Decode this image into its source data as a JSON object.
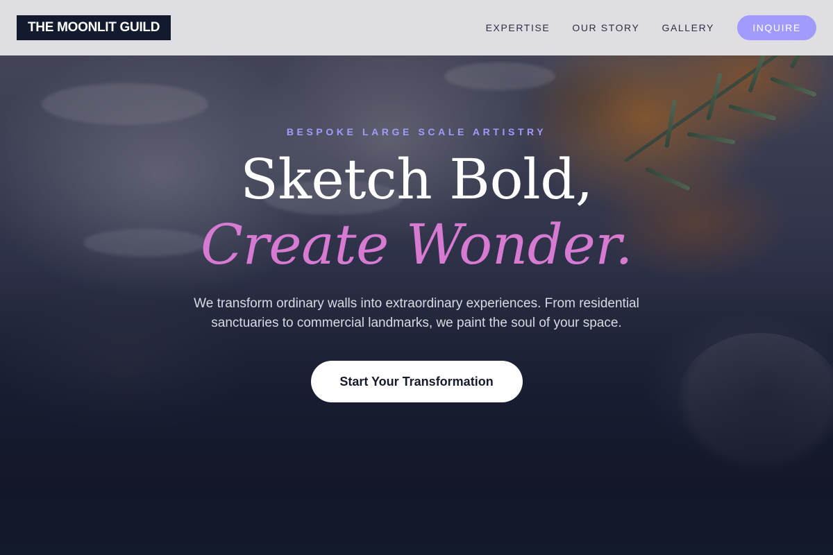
{
  "brand": {
    "logo_text": "THE MOONLIT GUILD"
  },
  "nav": {
    "links": [
      "EXPERTISE",
      "OUR STORY",
      "GALLERY"
    ],
    "cta_label": "INQUIRE"
  },
  "hero": {
    "eyebrow": "BESPOKE LARGE SCALE ARTISTRY",
    "headline_line1": "Sketch Bold,",
    "headline_line2": "Create Wonder.",
    "subtext": "We transform ordinary walls into extraordinary experiences. From residential sanctuaries to commercial landmarks, we paint the soul of your space.",
    "cta_label": "Start Your Transformation"
  },
  "colors": {
    "accent": "#a29bfe",
    "headline_accent": "#d67ad2",
    "header_bg": "#e9e9ee",
    "logo_bg": "#121a2e",
    "page_bottom": "#131a2c"
  }
}
